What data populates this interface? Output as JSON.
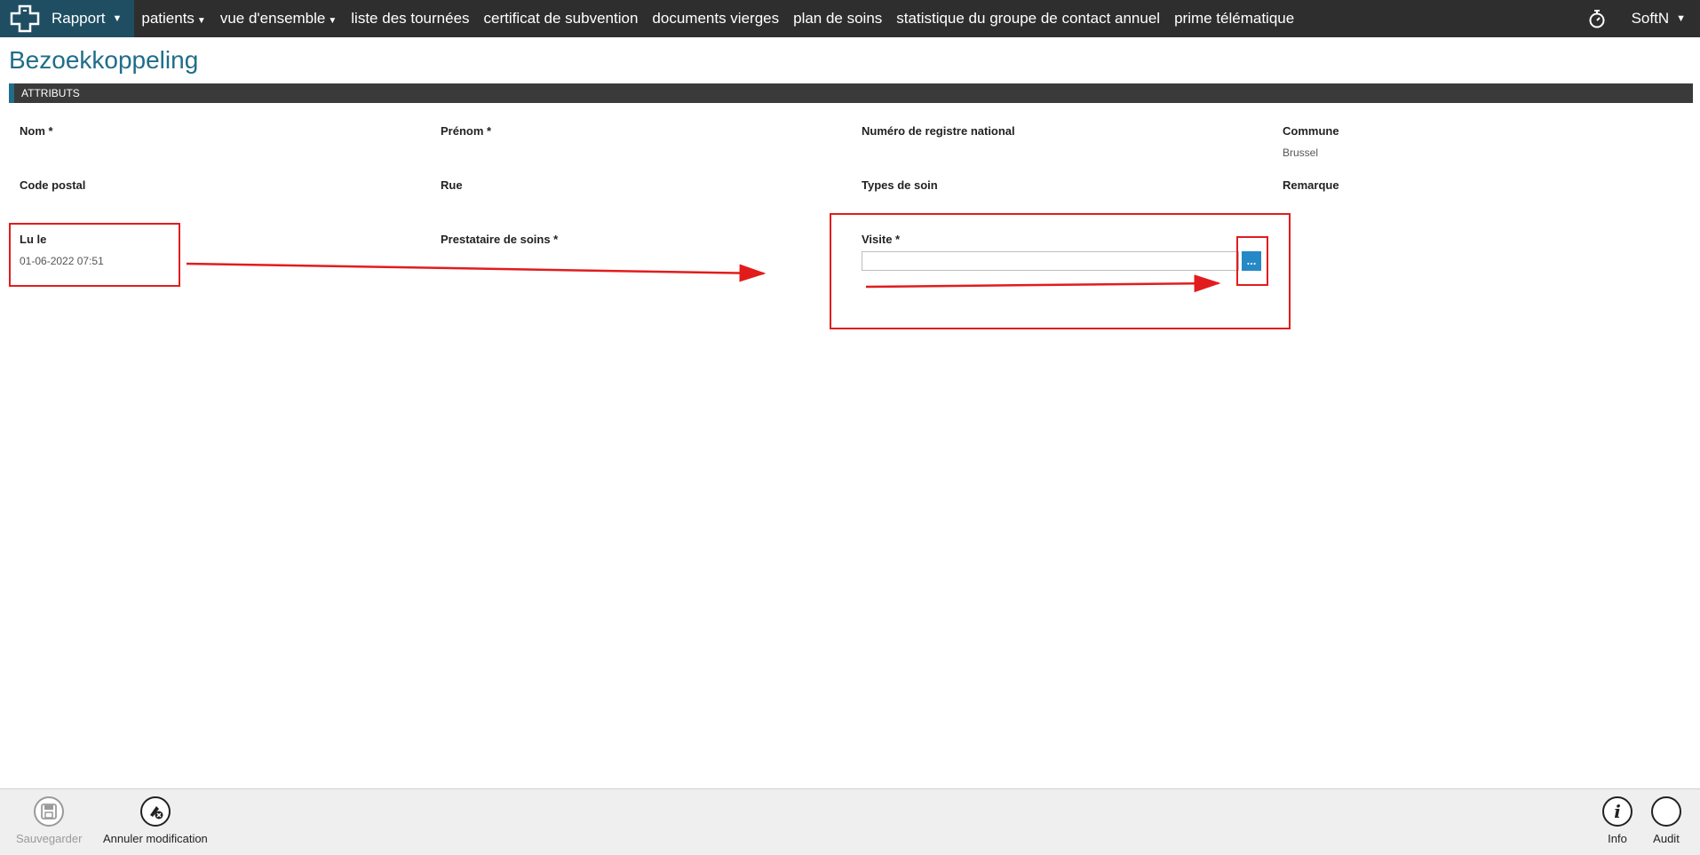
{
  "nav": {
    "brand_label": "Rapport",
    "items": [
      {
        "label": "patients",
        "dropdown": true
      },
      {
        "label": "vue d'ensemble",
        "dropdown": true
      },
      {
        "label": "liste des tournées",
        "dropdown": false
      },
      {
        "label": "certificat de subvention",
        "dropdown": false
      },
      {
        "label": "documents vierges",
        "dropdown": false
      },
      {
        "label": "plan de soins",
        "dropdown": false
      },
      {
        "label": "statistique du groupe de contact annuel",
        "dropdown": false
      },
      {
        "label": "prime télématique",
        "dropdown": false
      }
    ],
    "user_label": "SoftN"
  },
  "page": {
    "title": "Bezoekkoppeling",
    "section": "ATTRIBUTS"
  },
  "fields": {
    "nom": {
      "label": "Nom *",
      "value": ""
    },
    "prenom": {
      "label": "Prénom *",
      "value": ""
    },
    "registre": {
      "label": "Numéro de registre national",
      "value": ""
    },
    "commune": {
      "label": "Commune",
      "value": "Brussel"
    },
    "code_postal": {
      "label": "Code postal",
      "value": ""
    },
    "rue": {
      "label": "Rue",
      "value": ""
    },
    "types_soin": {
      "label": "Types de soin",
      "value": ""
    },
    "remarque": {
      "label": "Remarque",
      "value": ""
    },
    "lu_le": {
      "label": "Lu le",
      "value": "01-06-2022 07:51"
    },
    "prestataire": {
      "label": "Prestataire de soins *",
      "value": ""
    },
    "visite": {
      "label": "Visite *",
      "value": "",
      "button_label": "..."
    }
  },
  "footer": {
    "save_label": "Sauvegarder",
    "cancel_label": "Annuler modification",
    "info_label": "Info",
    "audit_label": "Audit"
  },
  "colors": {
    "topbar": "#2e2e2e",
    "brand": "#1f4e63",
    "title": "#1f6d8a",
    "accent_button": "#2589c7",
    "annotation": "#e21c1c"
  }
}
